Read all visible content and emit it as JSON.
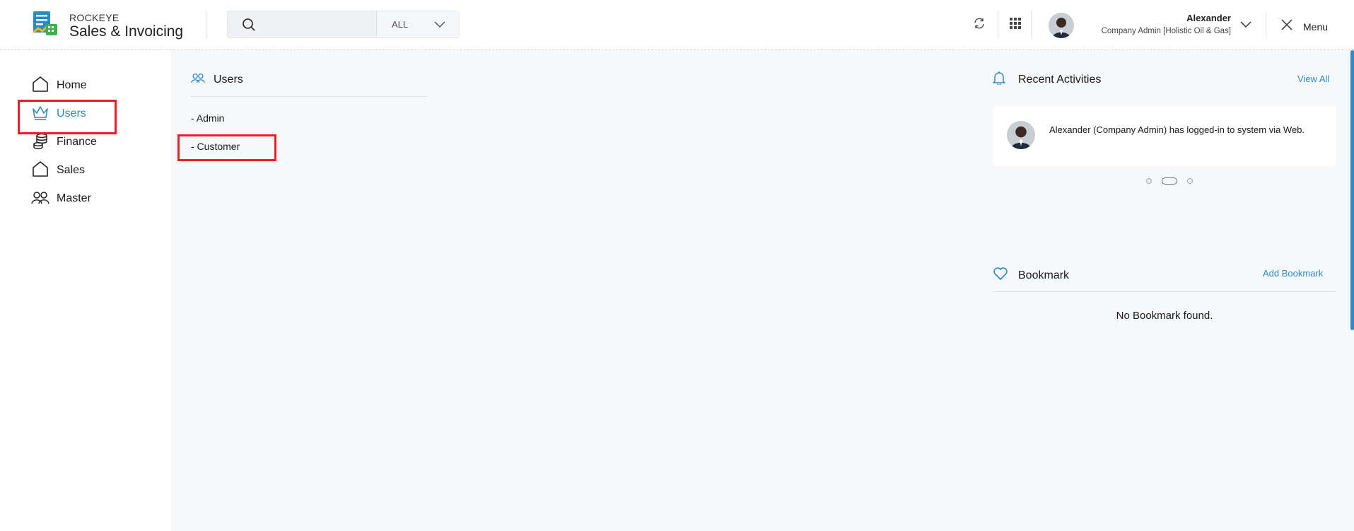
{
  "header": {
    "brand_small": "ROCKEYE",
    "brand_large": "Sales & Invoicing",
    "search": {
      "placeholder": "",
      "value": "",
      "filter_value": "ALL"
    },
    "user": {
      "name": "Alexander",
      "role": "Company Admin [Holistic Oil & Gas]"
    },
    "menu_label": "Menu"
  },
  "sidebar": {
    "items": [
      {
        "label": "Home",
        "icon": "home-icon"
      },
      {
        "label": "Users",
        "icon": "crown-icon",
        "active": true
      },
      {
        "label": "Finance",
        "icon": "coins-icon"
      },
      {
        "label": "Sales",
        "icon": "home-icon"
      },
      {
        "label": "Master",
        "icon": "users-icon"
      }
    ]
  },
  "users_panel": {
    "title": "Users",
    "items": [
      "- Admin",
      "- Customer"
    ]
  },
  "recent_activities": {
    "title": "Recent Activities",
    "view_all": "View All",
    "activity_text": "Alexander (Company Admin) has logged-in to system via Web."
  },
  "bookmark": {
    "title": "Bookmark",
    "add_label": "Add Bookmark",
    "empty_text": "No Bookmark found."
  },
  "colors": {
    "accent": "#2a8bc9",
    "highlight": "#ee1c24"
  }
}
